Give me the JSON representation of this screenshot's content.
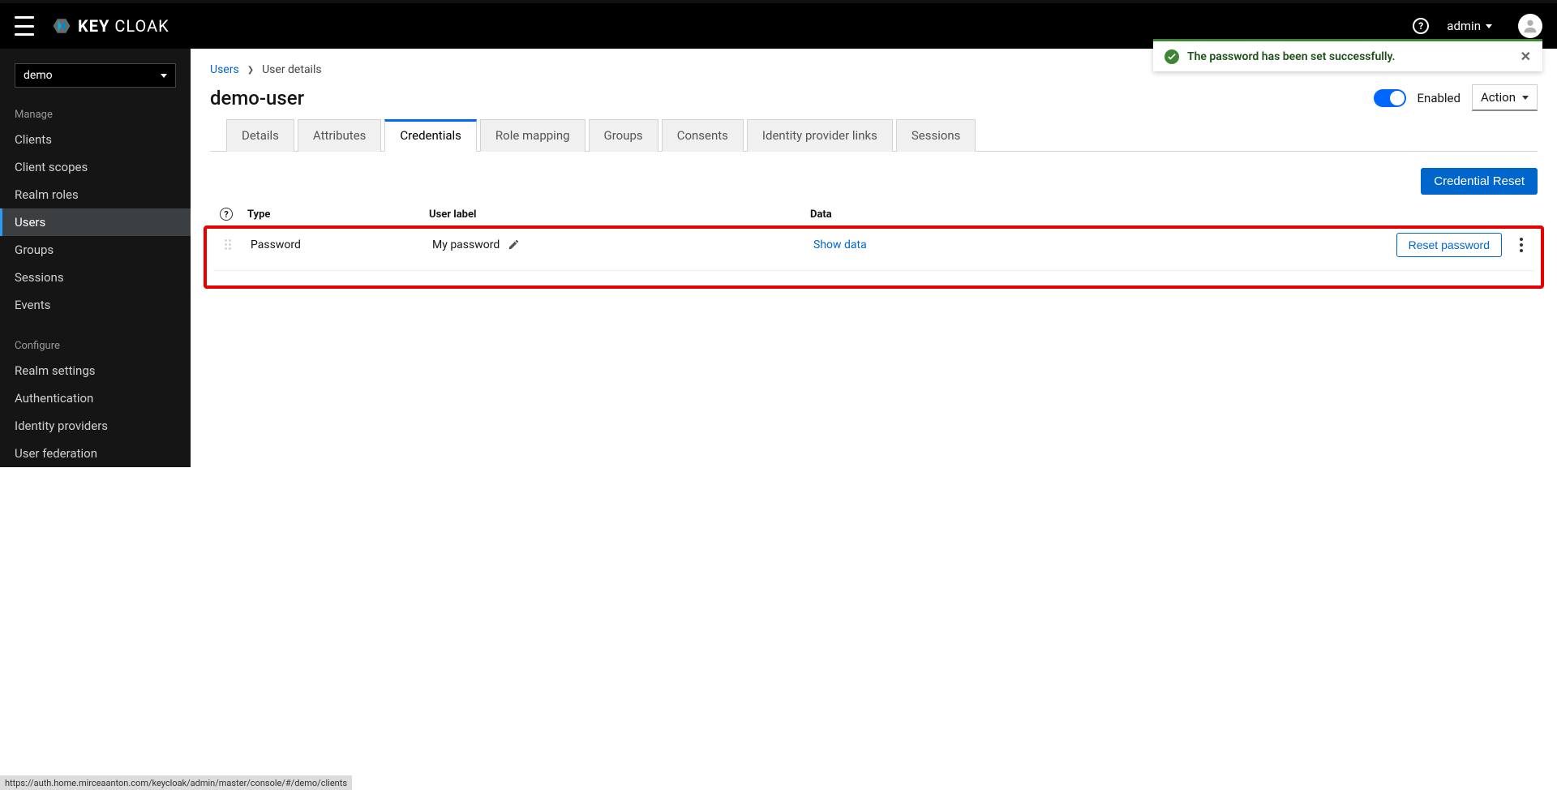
{
  "brand": {
    "name1": "KEY",
    "name2": "CLOAK"
  },
  "topbar": {
    "user": "admin"
  },
  "toast": {
    "message": "The password has been set successfully."
  },
  "realm_selector": {
    "value": "demo"
  },
  "sidebar": {
    "sections": [
      {
        "title": "Manage",
        "items": [
          "Clients",
          "Client scopes",
          "Realm roles",
          "Users",
          "Groups",
          "Sessions",
          "Events"
        ],
        "active": "Users"
      },
      {
        "title": "Configure",
        "items": [
          "Realm settings",
          "Authentication",
          "Identity providers",
          "User federation"
        ]
      }
    ]
  },
  "breadcrumb": {
    "root": "Users",
    "current": "User details"
  },
  "page": {
    "title": "demo-user",
    "enabled_label": "Enabled",
    "action_label": "Action"
  },
  "tabs": [
    "Details",
    "Attributes",
    "Credentials",
    "Role mapping",
    "Groups",
    "Consents",
    "Identity provider links",
    "Sessions"
  ],
  "active_tab": "Credentials",
  "credentials": {
    "reset_button": "Credential Reset",
    "columns": {
      "type": "Type",
      "label": "User label",
      "data": "Data"
    },
    "row": {
      "type": "Password",
      "label": "My password",
      "data_action": "Show data",
      "reset_action": "Reset password"
    }
  },
  "statusbar": "https://auth.home.mirceaanton.com/keycloak/admin/master/console/#/demo/clients"
}
